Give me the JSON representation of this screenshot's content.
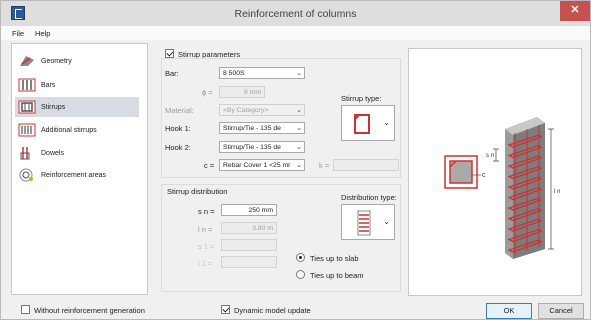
{
  "window": {
    "title": "Reinforcement of columns",
    "close_label": "✕"
  },
  "menu": [
    {
      "label": "File",
      "key": "F"
    },
    {
      "label": "Help"
    }
  ],
  "sidebar": {
    "items": [
      {
        "label": "Geometry",
        "icon": "geometry-icon"
      },
      {
        "label": "Bars",
        "icon": "bars-icon"
      },
      {
        "label": "Stirrups",
        "icon": "stirrups-icon",
        "selected": true
      },
      {
        "label": "Additional stirrups",
        "icon": "additional-stirrups-icon"
      },
      {
        "label": "Dowels",
        "icon": "dowels-icon"
      },
      {
        "label": "Reinforcement areas",
        "icon": "reinforcement-areas-icon"
      }
    ]
  },
  "stirrup_params": {
    "checkbox_label": "Stirrup parameters",
    "checked": true,
    "bar_label": "Bar:",
    "bar_value": "8 500S",
    "phi_label": "ɸ =",
    "phi_value": "8 mm",
    "material_label": "Material:",
    "material_value": "<By Category>",
    "hook1_label": "Hook 1:",
    "hook1_value": "Stirrup/Tie - 135 de",
    "hook2_label": "Hook 2:",
    "hook2_value": "Stirrup/Tie - 135 de",
    "c_label": "c =",
    "c_value": "Rebar Cover 1 <25 mr",
    "k_label": "k =",
    "stirrup_type_label": "Stirrup type:"
  },
  "stirrup_distribution": {
    "title": "Stirrup distribution",
    "sn_label": "s n =",
    "sn_value": "250 mm",
    "ln_label": "l n =",
    "ln_value": "3.80 m",
    "s1_label": "s 1 =",
    "l1_label": "l 1 =",
    "distribution_type_label": "Distribution type:",
    "radio_slab": "Ties up to slab",
    "radio_beam": "Ties up to beam",
    "selected": "slab"
  },
  "preview": {
    "label_c": "c",
    "label_sn": "s n",
    "label_ln": "l n"
  },
  "footer": {
    "no_generation_label": "Without reinforcement generation",
    "no_generation_checked": false,
    "dynamic_update_label": "Dynamic model update",
    "dynamic_update_checked": true,
    "ok_label": "OK",
    "cancel_label": "Cancel"
  },
  "colors": {
    "accent_red": "#d03030",
    "selection": "#d7dce4",
    "close_button": "#c75050"
  }
}
